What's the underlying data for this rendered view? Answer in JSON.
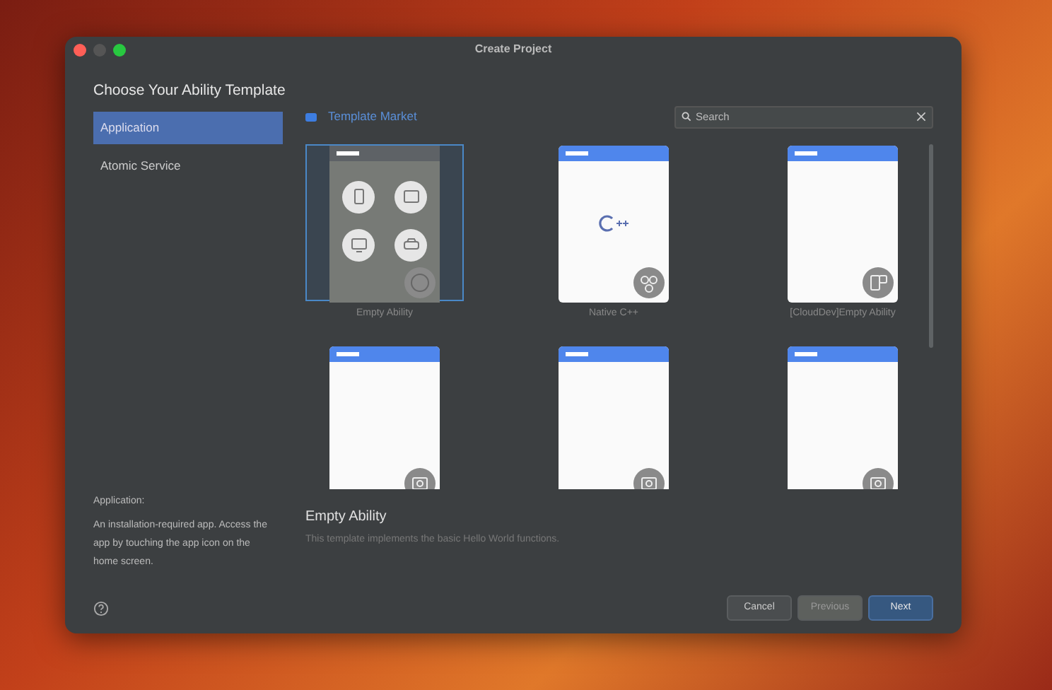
{
  "window": {
    "title": "Create Project"
  },
  "heading": "Choose Your Ability Template",
  "sidebar": {
    "items": [
      {
        "label": "Application",
        "selected": true
      },
      {
        "label": "Atomic Service",
        "selected": false
      }
    ],
    "description_title": "Application:",
    "description": "An installation-required app. Access the app by touching the app icon on the home screen."
  },
  "template_market": {
    "label": "Template Market"
  },
  "search": {
    "placeholder": "Search"
  },
  "templates": [
    {
      "kind": "devices",
      "label": "Empty Ability",
      "selected": true
    },
    {
      "kind": "cpp",
      "label": "Native C++",
      "selected": false
    },
    {
      "kind": "cloud",
      "label": "[CloudDev]Empty Ability",
      "selected": false
    },
    {
      "kind": "blank",
      "selected": false
    },
    {
      "kind": "blank",
      "selected": false
    },
    {
      "kind": "blank",
      "selected": false
    }
  ],
  "selected_template": {
    "title": "Empty Ability",
    "description": "This template implements the basic Hello World functions."
  },
  "buttons": [
    {
      "label": "Cancel",
      "kind": "secondary"
    },
    {
      "label": "Previous",
      "kind": "disabled"
    },
    {
      "label": "Next",
      "kind": "primary"
    }
  ]
}
